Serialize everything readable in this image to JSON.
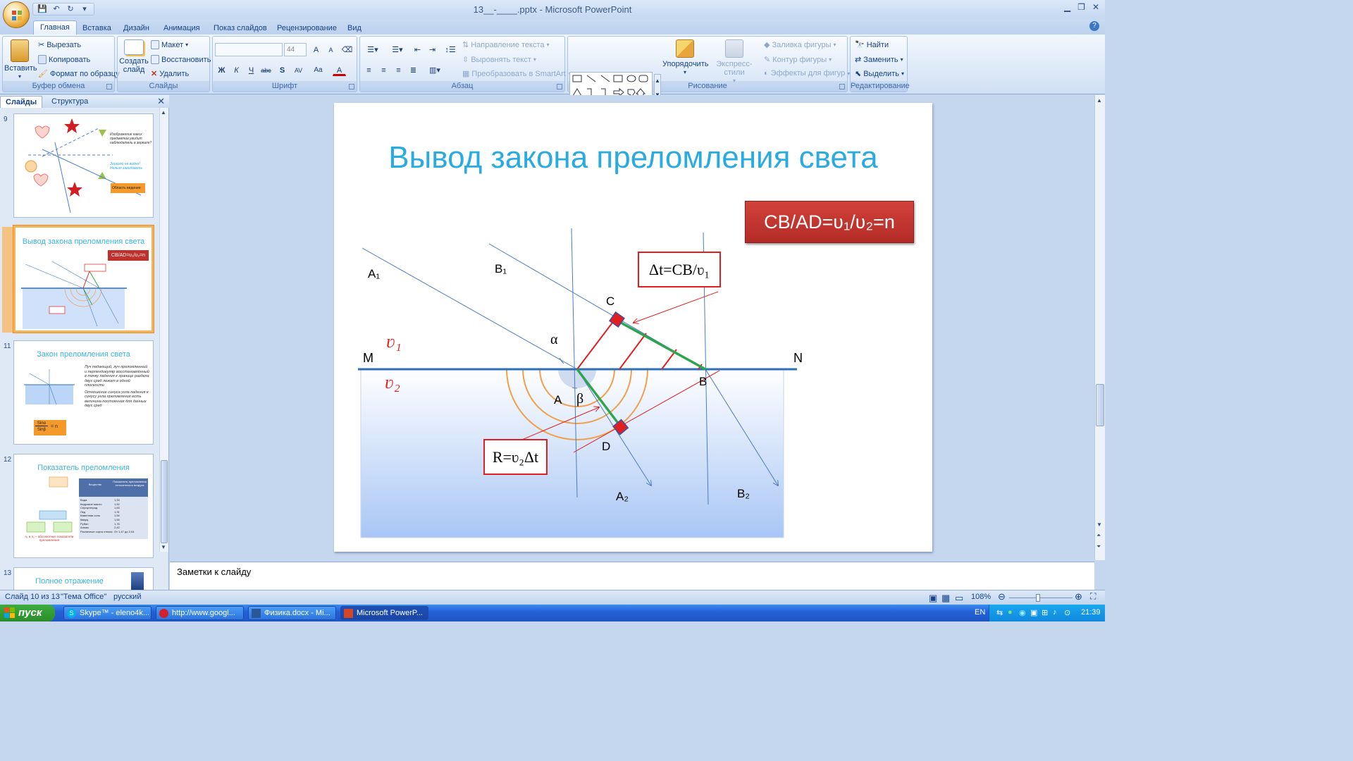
{
  "app": {
    "title": "13__-____.pptx - Microsoft PowerPoint"
  },
  "quick_access": {
    "save": "💾",
    "undo": "↶",
    "redo": "↻",
    "more": "▾"
  },
  "window_controls": {
    "minimize": "▁",
    "restore": "❐",
    "close": "✕"
  },
  "tabs": [
    "Главная",
    "Вставка",
    "Дизайн",
    "Анимация",
    "Показ слайдов",
    "Рецензирование",
    "Вид"
  ],
  "ribbon": {
    "clipboard": {
      "label": "Буфер обмена",
      "paste": "Вставить",
      "cut": "Вырезать",
      "copy": "Копировать",
      "format_painter": "Формат по образцу"
    },
    "slides": {
      "label": "Слайды",
      "new_slide_1": "Создать",
      "new_slide_2": "слайд",
      "layout": "Макет",
      "reset": "Восстановить",
      "delete": "Удалить"
    },
    "font": {
      "label": "Шрифт",
      "font_name": "",
      "font_size": "44",
      "grow": "A",
      "shrink": "A",
      "bold": "Ж",
      "italic": "К",
      "underline": "Ч",
      "strike": "abc",
      "shadow": "S",
      "spacing": "AV",
      "case": "Aa",
      "color": "A"
    },
    "paragraph": {
      "label": "Абзац",
      "text_direction": "Направление текста",
      "align_text": "Выровнять текст",
      "smartart": "Преобразовать в SmartArt"
    },
    "drawing": {
      "label": "Рисование",
      "arrange": "Упорядочить",
      "quick_styles": "Экспресс-стили",
      "shape_fill": "Заливка фигуры",
      "shape_outline": "Контур фигуры",
      "shape_effects": "Эффекты для фигур"
    },
    "editing": {
      "label": "Редактирование",
      "find": "Найти",
      "replace": "Заменить",
      "select": "Выделить"
    }
  },
  "panel": {
    "tab_slides": "Слайды",
    "tab_outline": "Структура",
    "close": "✕"
  },
  "thumbnails": [
    {
      "num": "9",
      "title": "",
      "texts": [
        "Изображение каких предметов увидит наблюдатель в зеркале?",
        "Зеркало не видно! Нельзя завидовать",
        "Область видения"
      ]
    },
    {
      "num": "10",
      "title": "Вывод закона преломления света",
      "badge": "CB/AD=ʋ₁/ʋ₂=n"
    },
    {
      "num": "11",
      "title": "Закон преломления света",
      "bullets": [
        "Луч падающий, луч преломленный и перпендикуляр восстановлённый в точку падения к границе раздела двух сред лежат в одной плоскости",
        "Отношение синуса угла падения к синусу угла преломления есть величина постоянная для данных двух сред"
      ],
      "formula_top": "Sinα",
      "formula_bottom": "Sinβ",
      "formula_eq": "= n"
    },
    {
      "num": "12",
      "title": "Показатель преломления",
      "table_head_1": "Вещество",
      "table_head_2": "Показатель преломления относительно воздуха",
      "table_rows": [
        [
          "Вода",
          "1,33"
        ],
        [
          "Кедровое масло",
          "1,52"
        ],
        [
          "Сероуглерод",
          "1,63"
        ],
        [
          "Лед",
          "1,31"
        ],
        [
          "Каменная соль",
          "1,54"
        ],
        [
          "Кварц",
          "1,54"
        ],
        [
          "Рубин",
          "1,76"
        ],
        [
          "Алмаз",
          "2,42"
        ],
        [
          "Различные сорта стекла",
          "От 1,47 до 2,04"
        ]
      ],
      "note": "n₁ и n₂ – абсолютные показатели преломления"
    },
    {
      "num": "13",
      "title": "Полное отражение"
    }
  ],
  "slide": {
    "title": "Вывод закона преломления света",
    "formula_box": "CB/AD=ʋ₁/ʋ₂=n",
    "dt_box": "Δt=CB/ʋ₁",
    "r_box": "R=ʋ₂Δt",
    "labels": {
      "A1": "A₁",
      "B1": "B₁",
      "A2": "A₂",
      "B2": "B₂",
      "M": "M",
      "N": "N",
      "A": "A",
      "B": "B",
      "C": "C",
      "D": "D",
      "alpha": "α",
      "beta": "β",
      "v1": "ʋ₁",
      "v2": "ʋ₂"
    }
  },
  "notes": {
    "placeholder": "Заметки к слайду"
  },
  "status": {
    "slide": "Слайд 10 из 13",
    "theme": "\"Тема Office\"",
    "lang": "русский",
    "zoom": "108%"
  },
  "taskbar": {
    "start": "пуск",
    "tasks": [
      "Skype™ - eleno4k...",
      "http://www.googl...",
      "Физика.docx - Mi...",
      "Microsoft PowerP..."
    ],
    "lang": "EN",
    "time": "21:39"
  },
  "colors": {
    "accent_title": "#29abe2",
    "formula_red": "#c0302c",
    "ray_blue": "#4a7cc0",
    "green": "#2ea44f",
    "red_line": "#e02020",
    "water": "#a8c6f5",
    "orange_arc": "#f0a04b"
  }
}
